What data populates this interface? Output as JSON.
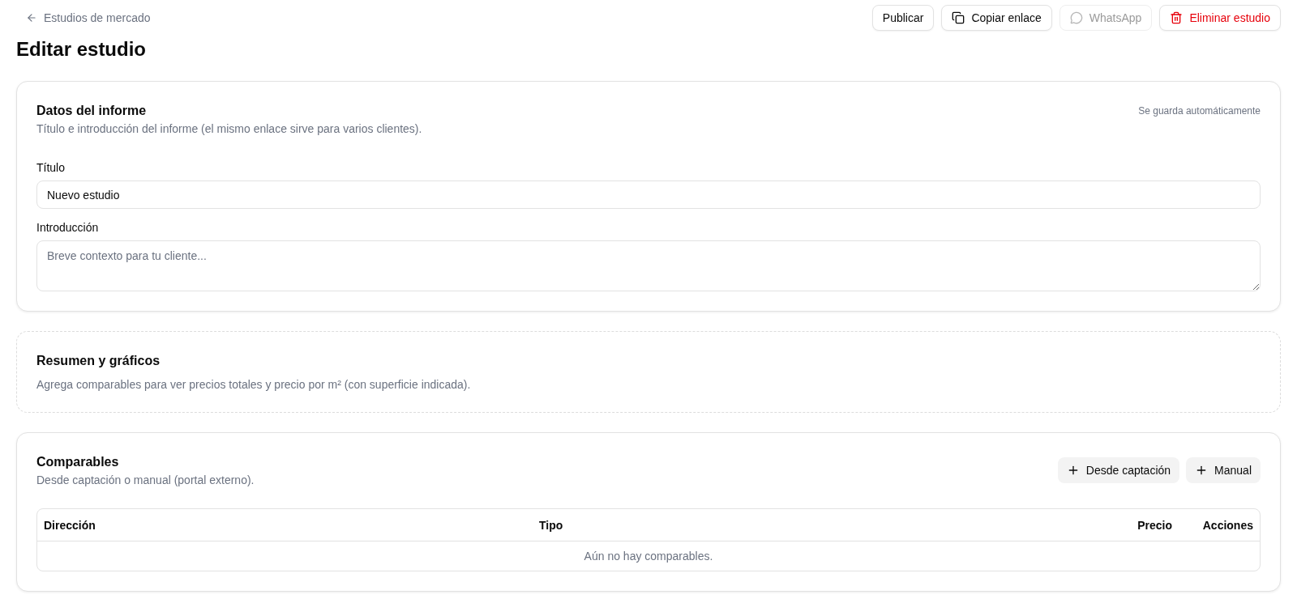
{
  "header": {
    "back_link": "Estudios de mercado",
    "actions": [
      {
        "label": "Publicar",
        "kind": "publish",
        "disabled": false
      },
      {
        "label": "Copiar enlace",
        "kind": "copy",
        "disabled": false
      },
      {
        "label": "WhatsApp",
        "kind": "whatsapp",
        "disabled": true
      },
      {
        "label": "Eliminar estudio",
        "kind": "delete",
        "disabled": false
      }
    ]
  },
  "page_title": "Editar estudio",
  "report_card": {
    "title": "Datos del informe",
    "subtitle": "Título e introducción del informe (el mismo enlace sirve para varios clientes).",
    "autosave_note": "Se guarda automáticamente",
    "fields": [
      {
        "kind": "input",
        "label": "Título",
        "value": "Nuevo estudio"
      },
      {
        "kind": "textarea",
        "label": "Introducción",
        "placeholder": "Breve contexto para tu cliente..."
      }
    ]
  },
  "summary_card": {
    "title": "Resumen y gráficos",
    "subtitle": "Agrega comparables para ver precios totales y precio por m² (con superficie indicada)."
  },
  "comparables_card": {
    "title": "Comparables",
    "subtitle": "Desde captación o manual (portal externo).",
    "buttons": [
      "Desde captación",
      "Manual"
    ],
    "table": {
      "columns": [
        "Dirección",
        "Tipo",
        "Precio",
        "Acciones"
      ],
      "empty_message": "Aún no hay comparables."
    }
  }
}
